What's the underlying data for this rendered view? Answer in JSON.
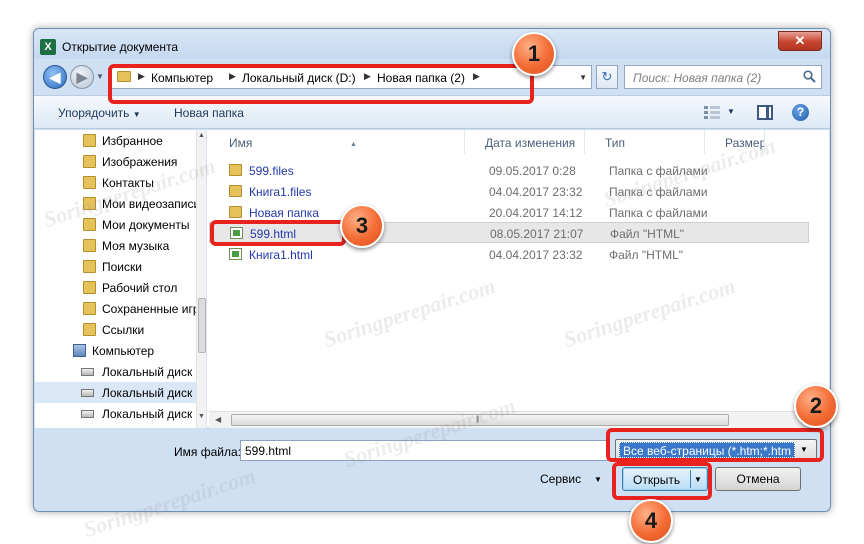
{
  "window": {
    "title": "Открытие документа",
    "app_icon": "X",
    "close_glyph": "✕"
  },
  "navigation": {
    "back_glyph": "◀",
    "forward_glyph": "▶",
    "breadcrumbs": [
      "Компьютер",
      "Локальный диск (D:)",
      "Новая папка (2)"
    ],
    "refresh_glyph": "↻",
    "search_placeholder": "Поиск: Новая папка (2)"
  },
  "toolbar": {
    "organize_label": "Упорядочить",
    "new_folder_label": "Новая папка"
  },
  "sidebar": {
    "items": [
      {
        "label": "Избранное",
        "icon": "favorites-folder-icon"
      },
      {
        "label": "Изображения",
        "icon": "folder-icon"
      },
      {
        "label": "Контакты",
        "icon": "folder-icon"
      },
      {
        "label": "Мои видеозаписи",
        "icon": "folder-icon"
      },
      {
        "label": "Мои документы",
        "icon": "folder-icon"
      },
      {
        "label": "Моя музыка",
        "icon": "folder-icon"
      },
      {
        "label": "Поиски",
        "icon": "folder-icon"
      },
      {
        "label": "Рабочий стол",
        "icon": "folder-icon"
      },
      {
        "label": "Сохраненные игры",
        "icon": "folder-icon"
      },
      {
        "label": "Ссылки",
        "icon": "folder-icon"
      },
      {
        "label": "Компьютер",
        "icon": "computer-icon"
      },
      {
        "label": "Локальный диск",
        "icon": "drive-icon"
      },
      {
        "label": "Локальный диск",
        "icon": "drive-icon"
      },
      {
        "label": "Локальный диск",
        "icon": "drive-icon"
      }
    ]
  },
  "file_list": {
    "columns": [
      "Имя",
      "Дата изменения",
      "Тип",
      "Размер"
    ],
    "rows": [
      {
        "name": "599.files",
        "date": "09.05.2017 0:28",
        "type": "Папка с файлами",
        "icon": "folder-icon"
      },
      {
        "name": "Книга1.files",
        "date": "04.04.2017 23:32",
        "type": "Папка с файлами",
        "icon": "folder-icon"
      },
      {
        "name": "Новая папка",
        "date": "20.04.2017 14:12",
        "type": "Папка с файлами",
        "icon": "folder-icon"
      },
      {
        "name": "599.html",
        "date": "08.05.2017 21:07",
        "type": "Файл \"HTML\"",
        "icon": "html-file-icon"
      },
      {
        "name": "Книга1.html",
        "date": "04.04.2017 23:32",
        "type": "Файл \"HTML\"",
        "icon": "html-file-icon"
      }
    ]
  },
  "bottom": {
    "filename_label": "Имя файла:",
    "filename_value": "599.html",
    "filetype_value": "Все веб-страницы (*.htm;*.htm",
    "service_label": "Сервис",
    "open_label": "Открыть",
    "cancel_label": "Отмена"
  },
  "callouts": [
    "1",
    "2",
    "3",
    "4"
  ],
  "watermark": "Soringperepair.com",
  "colors": {
    "highlight_border": "#e8231e",
    "badge_fill": "#f36a33",
    "selection": "#3a78c9"
  }
}
